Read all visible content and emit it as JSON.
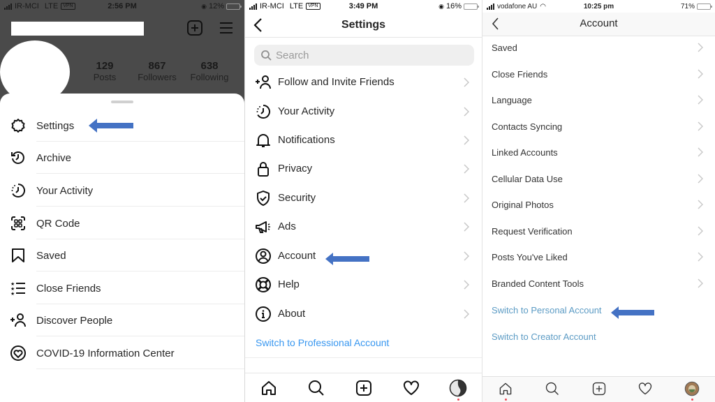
{
  "annotations": {
    "arrow_color": "#4472c4"
  },
  "profile_screen": {
    "status_bar": {
      "carrier": "IR-MCI",
      "network": "LTE",
      "vpn": "VPN",
      "time": "2:56 PM",
      "battery": "12%",
      "battery_level": 0.12,
      "battery_color": "#e0403a"
    },
    "header_icons": [
      "new-post-icon",
      "hamburger-menu-icon"
    ],
    "stats": [
      {
        "value": "129",
        "label": "Posts"
      },
      {
        "value": "867",
        "label": "Followers"
      },
      {
        "value": "638",
        "label": "Following"
      }
    ],
    "menu": [
      {
        "label": "Settings",
        "icon": "settings-gear-icon"
      },
      {
        "label": "Archive",
        "icon": "archive-clock-icon"
      },
      {
        "label": "Your Activity",
        "icon": "activity-icon"
      },
      {
        "label": "QR Code",
        "icon": "qr-code-icon"
      },
      {
        "label": "Saved",
        "icon": "bookmark-icon"
      },
      {
        "label": "Close Friends",
        "icon": "close-friends-list-icon"
      },
      {
        "label": "Discover People",
        "icon": "add-person-icon"
      },
      {
        "label": "COVID-19 Information Center",
        "icon": "covid-heart-icon"
      }
    ],
    "highlighted_item": "Settings"
  },
  "settings_screen": {
    "status_bar": {
      "carrier": "IR-MCI",
      "network": "LTE",
      "vpn": "VPN",
      "time": "3:49 PM",
      "battery": "16%",
      "battery_level": 0.16,
      "battery_color": "#e0403a"
    },
    "title": "Settings",
    "search_placeholder": "Search",
    "items": [
      {
        "label": "Follow and Invite Friends",
        "icon": "add-person-icon"
      },
      {
        "label": "Your Activity",
        "icon": "activity-icon"
      },
      {
        "label": "Notifications",
        "icon": "bell-icon"
      },
      {
        "label": "Privacy",
        "icon": "lock-icon"
      },
      {
        "label": "Security",
        "icon": "shield-check-icon"
      },
      {
        "label": "Ads",
        "icon": "megaphone-icon"
      },
      {
        "label": "Account",
        "icon": "account-circle-icon"
      },
      {
        "label": "Help",
        "icon": "lifebuoy-icon"
      },
      {
        "label": "About",
        "icon": "info-icon"
      }
    ],
    "highlighted_item": "Account",
    "switch_link": "Switch to Professional Account",
    "tabs": [
      "home-icon",
      "search-icon",
      "new-post-icon",
      "heart-icon",
      "profile-avatar-icon"
    ]
  },
  "account_screen": {
    "status_bar": {
      "carrier": "vodafone AU",
      "time": "10:25 pm",
      "battery": "71%",
      "battery_level": 0.71,
      "battery_color": "#f5c518"
    },
    "title": "Account",
    "items": [
      "Saved",
      "Close Friends",
      "Language",
      "Contacts Syncing",
      "Linked Accounts",
      "Cellular Data Use",
      "Original Photos",
      "Request Verification",
      "Posts You've Liked",
      "Branded Content Tools"
    ],
    "links": [
      "Switch to Personal Account",
      "Switch to Creator Account"
    ],
    "highlighted_item": "Switch to Personal Account",
    "tabs": [
      "home-icon",
      "search-icon",
      "new-post-icon",
      "heart-icon",
      "profile-avatar-icon"
    ]
  }
}
